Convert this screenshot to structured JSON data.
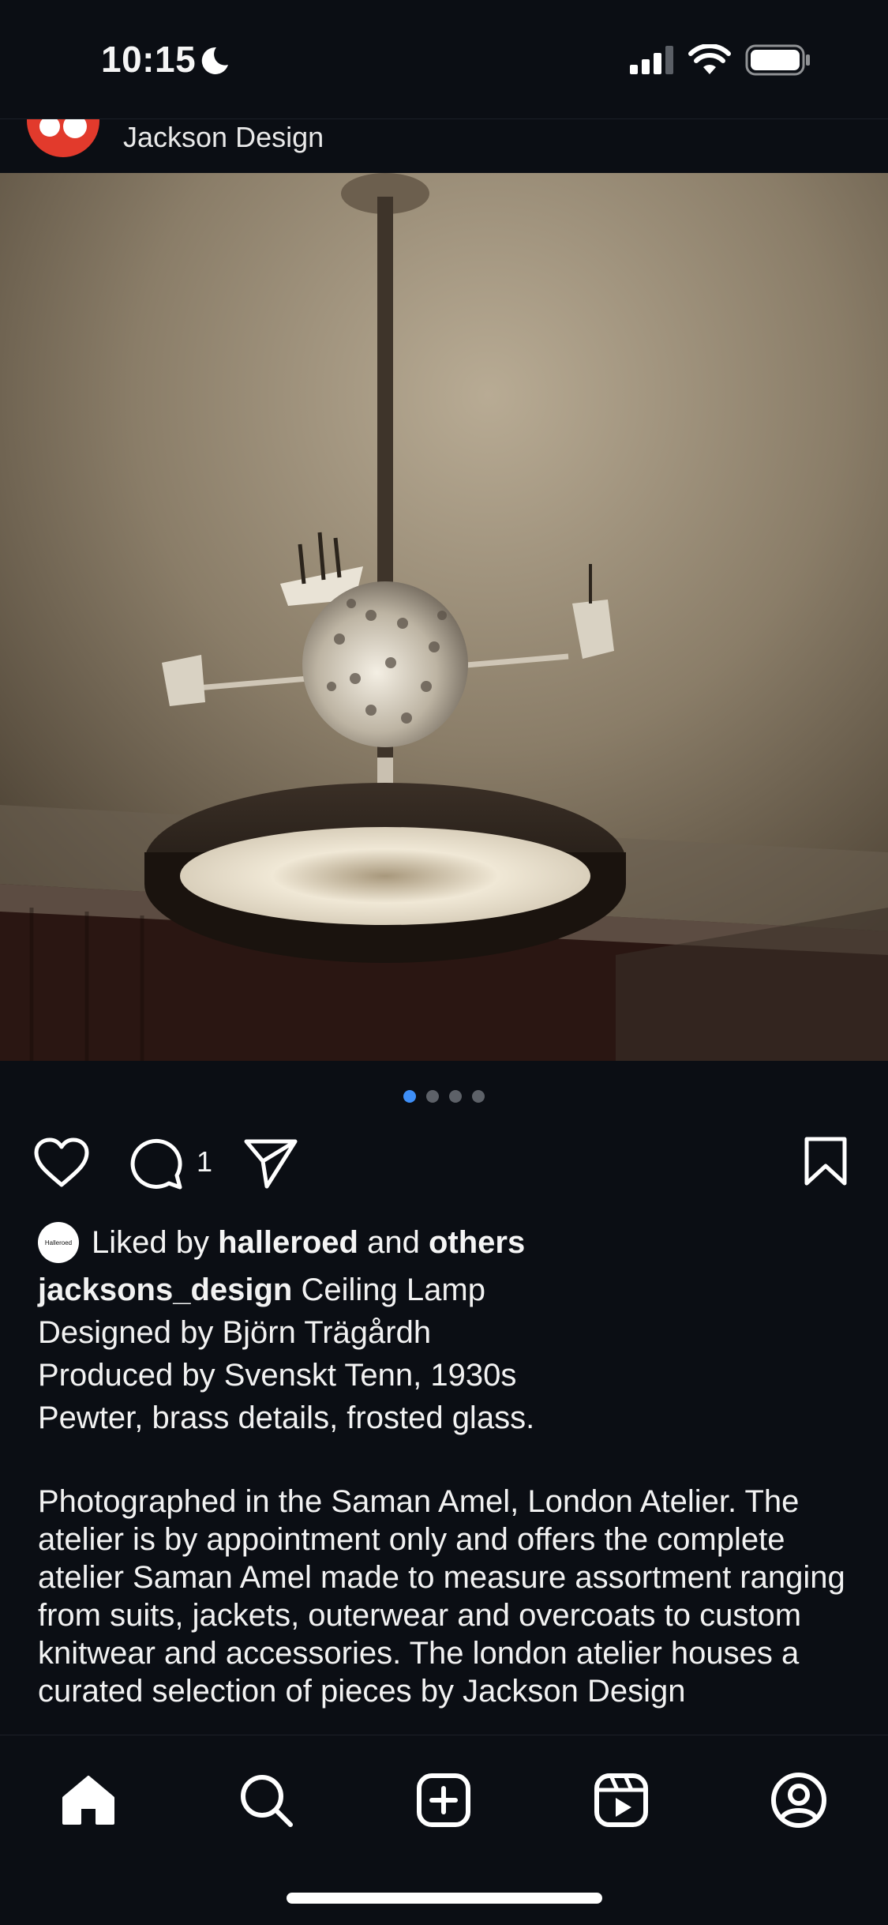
{
  "status_bar": {
    "time": "10:15"
  },
  "post": {
    "author_display": "Jackson Design",
    "photo_count": 4,
    "active_photo_index": 0,
    "comment_count": "1"
  },
  "likes": {
    "avatar_label": "Halleroed",
    "prefix": "Liked by",
    "user": "halleroed",
    "middle": "and",
    "others": "others"
  },
  "caption": {
    "username": "jacksons_design",
    "line1_rest": "Ceiling Lamp",
    "line2": "Designed by Björn Trägårdh",
    "line3": "Produced by Svenskt Tenn, 1930s",
    "line4": "Pewter, brass details, frosted glass.",
    "description": "Photographed in the Saman Amel, London Atelier. The atelier is by appointment only and offers the complete atelier Saman Amel made to measure assortment ranging from suits, jackets, outerwear and overcoats to custom knitwear and accessories. The london atelier houses a curated selection of pieces by Jackson Design"
  },
  "icons": {
    "moon": "moon-icon",
    "signal": "signal-icon",
    "wifi": "wifi-icon",
    "battery": "battery-icon",
    "like": "heart-icon",
    "comment": "comment-icon",
    "share": "send-icon",
    "save": "bookmark-icon",
    "tabs": [
      "home-icon",
      "search-icon",
      "create-icon",
      "reels-icon",
      "profile-icon"
    ]
  },
  "colors": {
    "background": "#0b0e14",
    "avatar_brand": "#e23a2c",
    "carousel_active": "#3f8ff7"
  }
}
